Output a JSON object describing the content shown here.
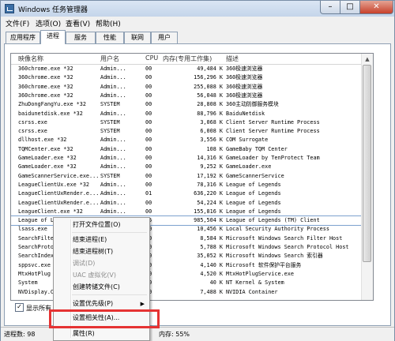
{
  "window": {
    "title": "Windows 任务管理器"
  },
  "menubar": {
    "items": [
      "文件(F)",
      "选项(O)",
      "查看(V)",
      "帮助(H)"
    ]
  },
  "tabs": [
    "应用程序",
    "进程",
    "服务",
    "性能",
    "联网",
    "用户"
  ],
  "table": {
    "headers": [
      "映像名称",
      "用户名",
      "CPU",
      "内存(专用工作集)",
      "描述"
    ],
    "rows": [
      [
        "360chrome.exe *32",
        "Admin...",
        "00",
        "49,484 K",
        "360极速浏览器"
      ],
      [
        "360chrome.exe *32",
        "Admin...",
        "00",
        "156,296 K",
        "360极速浏览器"
      ],
      [
        "360chrome.exe *32",
        "Admin...",
        "00",
        "255,088 K",
        "360极速浏览器"
      ],
      [
        "360chrome.exe *32",
        "Admin...",
        "00",
        "56,048 K",
        "360极速浏览器"
      ],
      [
        "ZhuDongFangYu.exe *32",
        "SYSTEM",
        "00",
        "28,808 K",
        "360主动防御服务模块"
      ],
      [
        "baidunetdisk.exe *32",
        "Admin...",
        "00",
        "88,796 K",
        "BaiduNetdisk"
      ],
      [
        "csrss.exe",
        "SYSTEM",
        "00",
        "3,068 K",
        "Client Server Runtime Process"
      ],
      [
        "csrss.exe",
        "SYSTEM",
        "00",
        "6,008 K",
        "Client Server Runtime Process"
      ],
      [
        "dllhost.exe *32",
        "Admin...",
        "00",
        "3,556 K",
        "COM Surrogate"
      ],
      [
        "TQMCenter.exe *32",
        "Admin...",
        "00",
        "108 K",
        "GameBaby TQM Center"
      ],
      [
        "GameLoader.exe *32",
        "Admin...",
        "00",
        "14,316 K",
        "GameLoader by TenProtect Team"
      ],
      [
        "GameLoader.exe *32",
        "Admin...",
        "00",
        "9,252 K",
        "GameLoader.exe"
      ],
      [
        "GameScannerService.exe...",
        "SYSTEM",
        "00",
        "17,192 K",
        "GameScannerService"
      ],
      [
        "LeagueClientUx.exe *32",
        "Admin...",
        "00",
        "78,316 K",
        "League of Legends"
      ],
      [
        "LeagueClientUxRender.e...",
        "Admin...",
        "01",
        "636,220 K",
        "League of Legends"
      ],
      [
        "LeagueClientUxRender.e...",
        "Admin...",
        "00",
        "54,224 K",
        "League of Legends"
      ],
      [
        "LeagueClient.exe *32",
        "Admin...",
        "00",
        "155,816 K",
        "League of Legends"
      ],
      [
        "League of Legends.exe *32",
        "Admin...",
        "05",
        "985,504 K",
        "League of Legends (TM) Client"
      ],
      [
        "lsass.exe",
        "",
        "00",
        "10,456 K",
        "Local Security Authority Process"
      ],
      [
        "SearchFilte",
        "",
        "00",
        "8,584 K",
        "Microsoft Windows Search Filter Host"
      ],
      [
        "SearchProto",
        "",
        "00",
        "5,788 K",
        "Microsoft Windows Search Protocol Host"
      ],
      [
        "SearchIndex",
        "",
        "00",
        "35,052 K",
        "Microsoft Windows Search 索引器"
      ],
      [
        "sppsvc.exe",
        "",
        "00",
        "4,140 K",
        "Microsoft 软件保护平台服务"
      ],
      [
        "MtxHotPlug",
        "",
        "00",
        "4,520 K",
        "MtxHotPlugService.exe"
      ],
      [
        "System",
        "",
        "00",
        "40 K",
        "NT Kernel & System"
      ],
      [
        "NVDisplay.C",
        "",
        "00",
        "7,488 K",
        "NVIDIA Container"
      ]
    ],
    "selected_index": 17
  },
  "show_all": {
    "label": "显示所有"
  },
  "status": {
    "processes": "进程数: 98",
    "memory": "内存: 55%"
  },
  "context_menu": {
    "items": [
      {
        "label": "打开文件位置(O)",
        "disabled": false
      },
      {
        "label": "结束进程(E)",
        "disabled": false
      },
      {
        "label": "结束进程树(T)",
        "disabled": false
      },
      {
        "label": "调试(D)",
        "disabled": true
      },
      {
        "label": "UAC 虚拟化(V)",
        "disabled": true
      },
      {
        "label": "创建转储文件(C)",
        "disabled": false
      },
      {
        "label": "设置优先级(P)",
        "disabled": false
      },
      {
        "label": "设置相关性(A)...",
        "disabled": false
      },
      {
        "label": "属性(R)",
        "disabled": false
      }
    ]
  },
  "colors": {
    "highlight_box": "#e53333",
    "selection_border": "#7da2ce",
    "close_button": "#c7412b"
  }
}
